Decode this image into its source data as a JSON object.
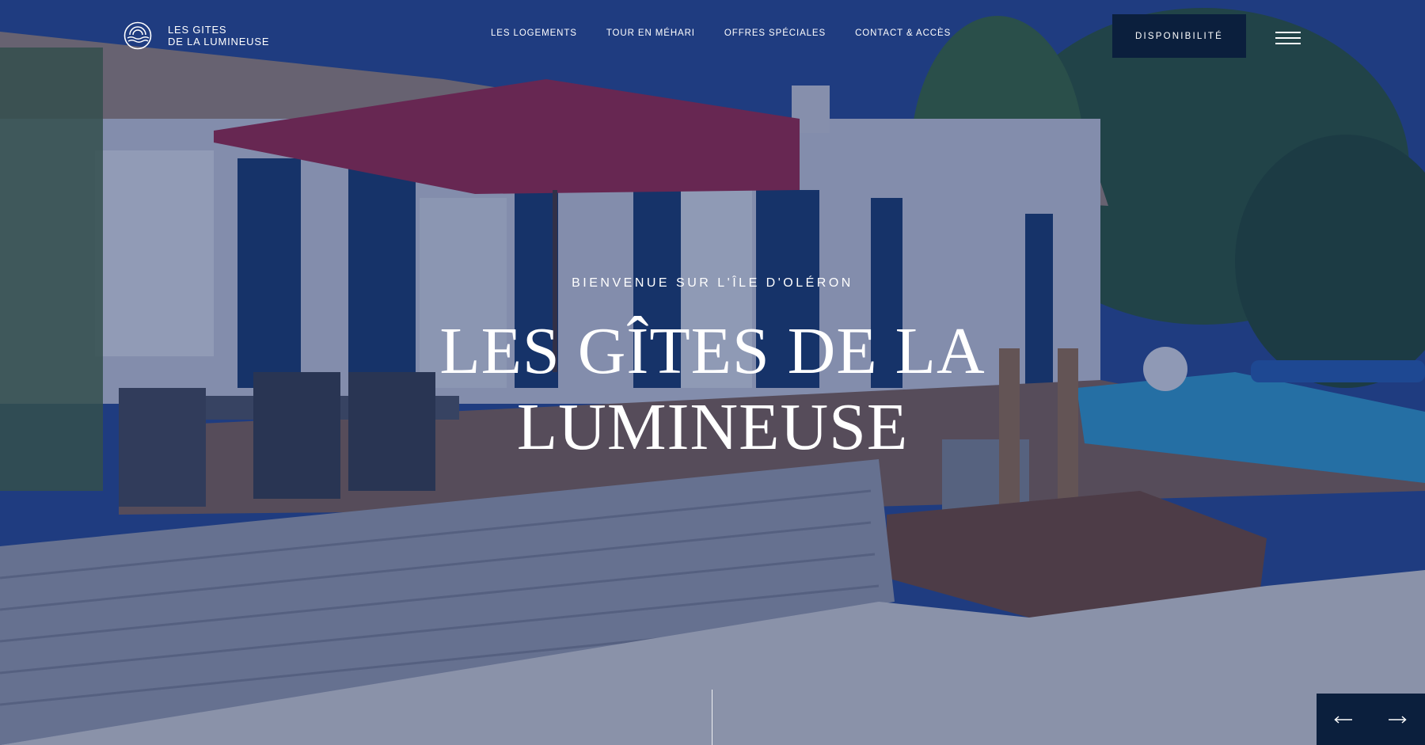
{
  "brand": {
    "line1": "LES GITES",
    "line2": "DE LA LUMINEUSE"
  },
  "nav": {
    "items": [
      {
        "label": "LES LOGEMENTS"
      },
      {
        "label": "TOUR EN MÉHARI"
      },
      {
        "label": "OFFRES SPÉCIALES"
      },
      {
        "label": "CONTACT & ACCÈS"
      }
    ]
  },
  "header": {
    "cta_label": "DISPONIBILITÉ",
    "menu_icon": "hamburger-icon"
  },
  "hero": {
    "eyebrow": "BIENVENUE SUR L'ÎLE D'OLÉRON",
    "title_line1": "LES GÎTES DE LA",
    "title_line2": "LUMINEUSE",
    "background": "photo-house-umbrella-pool"
  },
  "slider": {
    "prev_icon": "arrow-left-icon",
    "next_icon": "arrow-right-icon"
  },
  "colors": {
    "overlay": "#0e245c",
    "dark_navy": "#0b1f3d",
    "text": "#ffffff"
  }
}
